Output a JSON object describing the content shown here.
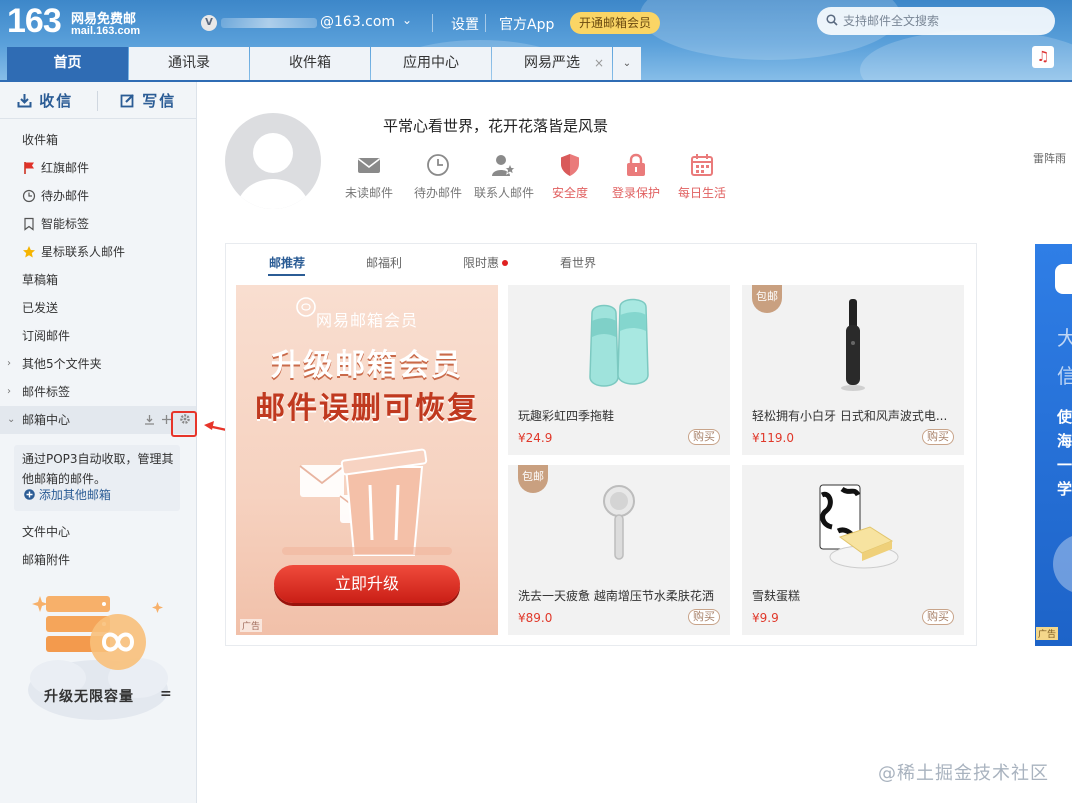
{
  "header": {
    "logo_number": "163",
    "logo_name": "网易免费邮",
    "logo_url": "mail.163.com",
    "vip_badge": "V",
    "account_domain": "@163.com",
    "account_caret": "⌄",
    "settings_label": "设置",
    "app_label": "官方App",
    "vip_button_label": "开通邮箱会员",
    "search_placeholder": "支持邮件全文搜索"
  },
  "nav_tabs": [
    {
      "label": "首页",
      "active": true
    },
    {
      "label": "通讯录"
    },
    {
      "label": "收件箱"
    },
    {
      "label": "应用中心"
    },
    {
      "label": "网易严选",
      "close": "×"
    }
  ],
  "nav_more_label": "⌄",
  "music_label": "♫",
  "sidebar": {
    "receive_label": "收信",
    "write_label": "写信",
    "folders": [
      {
        "label": "收件箱"
      },
      {
        "label": "红旗邮件",
        "icon": "red-flag-icon"
      },
      {
        "label": "待办邮件",
        "icon": "clock-icon"
      },
      {
        "label": "智能标签",
        "icon": "bookmark-icon"
      },
      {
        "label": "星标联系人邮件",
        "icon": "star-icon"
      },
      {
        "label": "草稿箱"
      },
      {
        "label": "已发送"
      },
      {
        "label": "订阅邮件"
      },
      {
        "label": "其他5个文件夹",
        "chevron": "›"
      },
      {
        "label": "邮件标签",
        "chevron": "›"
      },
      {
        "label": "邮箱中心",
        "chevron": "⌄"
      }
    ],
    "pop3_text": "通过POP3自动收取，管理其他邮箱的邮件。",
    "add_mailbox_label": "添加其他邮箱",
    "lower_folders": [
      {
        "label": "文件中心"
      },
      {
        "label": "邮箱附件"
      }
    ],
    "storage_promo": "升级无限容量",
    "storage_promo_suffix": "="
  },
  "profile": {
    "motto": "平常心看世界，花开花落皆是风景",
    "quick_links": [
      {
        "label": "未读邮件",
        "icon": "envelope-icon",
        "color": "gray"
      },
      {
        "label": "待办邮件",
        "icon": "clock-icon",
        "color": "gray"
      },
      {
        "label": "联系人邮件",
        "icon": "contact-star-icon",
        "color": "gray"
      },
      {
        "label": "安全度",
        "icon": "shield-icon",
        "color": "red"
      },
      {
        "label": "登录保护",
        "icon": "lock-icon",
        "color": "red"
      },
      {
        "label": "每日生活",
        "icon": "calendar-icon",
        "color": "red"
      }
    ],
    "weather": "雷阵雨"
  },
  "feed": {
    "tabs": [
      {
        "label": "邮推荐",
        "active": true
      },
      {
        "label": "邮福利"
      },
      {
        "label": "限时惠",
        "dot": true
      },
      {
        "label": "看世界"
      }
    ],
    "ad": {
      "brand": "网易邮箱会员",
      "line1": "升级邮箱会员",
      "line2": "邮件误删可恢复",
      "button": "立即升级",
      "tag": "广告"
    },
    "products": [
      {
        "name": "玩趣彩虹四季拖鞋",
        "price": "¥24.9",
        "buy": "购买",
        "image": "slippers"
      },
      {
        "name": "轻松拥有小白牙 日式和风声波式电...",
        "price": "¥119.0",
        "buy": "购买",
        "tag": "包邮",
        "image": "toothbrush"
      },
      {
        "name": "洗去一天疲惫 越南增压节水柔肤花洒",
        "price": "¥89.0",
        "buy": "购买",
        "tag": "包邮",
        "image": "showerhead"
      },
      {
        "name": "雪麸蛋糕",
        "price": "¥9.9",
        "buy": "购买",
        "image": "cake"
      }
    ]
  },
  "right_ad": {
    "chars": [
      "大",
      "信",
      "使",
      "海",
      "一",
      "学"
    ],
    "tag": "广告"
  },
  "watermark": "@稀土掘金技术社区",
  "colors": {
    "brand_blue": "#2f6cb4",
    "accent_red": "#e0382a",
    "vip_gold": "#fad565"
  }
}
